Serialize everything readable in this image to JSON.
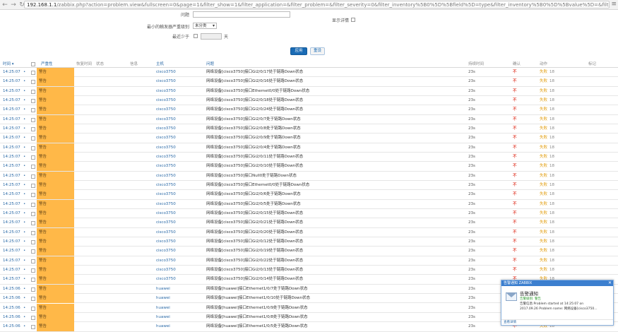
{
  "browser": {
    "back_icon": "back-arrow-icon",
    "forward_icon": "forward-arrow-icon",
    "url_host": "192.168.1.1",
    "url_path": "/zabbix.php?action=problem.view&fullscreen=0&page=1&filter_show=1&filter_application=&filter_problem=&filter_severity=0&filter_inventory%5B0%5D%5Bfield%5D=type&filter_inventory%5B0%5D%5Bvalue%5D=&filter_tags%5B0%5D",
    "menu_icon": "menu-icon"
  },
  "filter": {
    "problem_label": "问题",
    "problem_value": "",
    "min_severity_label": "最小的触发器严重级别",
    "min_severity_value": "未分类",
    "show_details_label": "显示详情",
    "age_label": "最近少于",
    "age_value": "",
    "age_unit": "天",
    "apply_label": "应用",
    "reset_label": "重设"
  },
  "table": {
    "headers": {
      "time": "时间 ▾",
      "severity": "严重性",
      "recovery_time": "恢复时间",
      "status": "状态",
      "info": "信息",
      "host": "主机",
      "problem": "问题",
      "duration": "持续时间",
      "ack": "确认",
      "actions": "动作",
      "tags": "标记"
    },
    "rows": [
      {
        "time": "14:25:07",
        "severity": "警告",
        "host": "cisco3750",
        "problem": "网络设备[cisco3750]接口Gi2/0/17处于链路Down状态",
        "duration": "23s",
        "ack": "不",
        "actions": "失败",
        "actions_count": "18"
      },
      {
        "time": "14:25:07",
        "severity": "警告",
        "host": "cisco3750",
        "problem": "网络设备[cisco3750]接口Gi2/0/16处于链路Down状态",
        "duration": "23s",
        "ack": "不",
        "actions": "失败",
        "actions_count": "18"
      },
      {
        "time": "14:25:07",
        "severity": "警告",
        "host": "cisco3750",
        "problem": "网络设备[cisco3750]接口Ethernet0/0处于链路Down状态",
        "duration": "23s",
        "ack": "不",
        "actions": "失败",
        "actions_count": "18"
      },
      {
        "time": "14:25:07",
        "severity": "警告",
        "host": "cisco3750",
        "problem": "网络设备[cisco3750]接口Gi2/0/18处于链路Down状态",
        "duration": "23s",
        "ack": "不",
        "actions": "失败",
        "actions_count": "18"
      },
      {
        "time": "14:25:07",
        "severity": "警告",
        "host": "cisco3750",
        "problem": "网络设备[cisco3750]接口Gi2/0/24处于链路Down状态",
        "duration": "23s",
        "ack": "不",
        "actions": "失败",
        "actions_count": "18"
      },
      {
        "time": "14:25:07",
        "severity": "警告",
        "host": "cisco3750",
        "problem": "网络设备[cisco3750]接口Gi2/0/7处于链路Down状态",
        "duration": "23s",
        "ack": "不",
        "actions": "失败",
        "actions_count": "18"
      },
      {
        "time": "14:25:07",
        "severity": "警告",
        "host": "cisco3750",
        "problem": "网络设备[cisco3750]接口Gi2/0/8处于链路Down状态",
        "duration": "23s",
        "ack": "不",
        "actions": "失败",
        "actions_count": "18"
      },
      {
        "time": "14:25:07",
        "severity": "警告",
        "host": "cisco3750",
        "problem": "网络设备[cisco3750]接口Gi2/0/9处于链路Down状态",
        "duration": "23s",
        "ack": "不",
        "actions": "失败",
        "actions_count": "18"
      },
      {
        "time": "14:25:07",
        "severity": "警告",
        "host": "cisco3750",
        "problem": "网络设备[cisco3750]接口Gi2/0/4处于链路Down状态",
        "duration": "23s",
        "ack": "不",
        "actions": "失败",
        "actions_count": "18"
      },
      {
        "time": "14:25:07",
        "severity": "警告",
        "host": "cisco3750",
        "problem": "网络设备[cisco3750]接口Gi2/0/11处于链路Down状态",
        "duration": "23s",
        "ack": "不",
        "actions": "失败",
        "actions_count": "18"
      },
      {
        "time": "14:25:07",
        "severity": "警告",
        "host": "cisco3750",
        "problem": "网络设备[cisco3750]接口Gi2/0/10处于链路Down状态",
        "duration": "23s",
        "ack": "不",
        "actions": "失败",
        "actions_count": "18"
      },
      {
        "time": "14:25:07",
        "severity": "警告",
        "host": "cisco3750",
        "problem": "网络设备[cisco3750]接口Null0处于链路Down状态",
        "duration": "23s",
        "ack": "不",
        "actions": "失败",
        "actions_count": "18"
      },
      {
        "time": "14:25:07",
        "severity": "警告",
        "host": "cisco3750",
        "problem": "网络设备[cisco3750]接口Ethernet0/0处于链路Down状态",
        "duration": "23s",
        "ack": "不",
        "actions": "失败",
        "actions_count": "18"
      },
      {
        "time": "14:25:07",
        "severity": "警告",
        "host": "cisco3750",
        "problem": "网络设备[cisco3750]接口Gi2/0/6处于链路Down状态",
        "duration": "23s",
        "ack": "不",
        "actions": "失败",
        "actions_count": "18"
      },
      {
        "time": "14:25:07",
        "severity": "警告",
        "host": "cisco3750",
        "problem": "网络设备[cisco3750]接口Gi2/0/5处于链路Down状态",
        "duration": "23s",
        "ack": "不",
        "actions": "失败",
        "actions_count": "18"
      },
      {
        "time": "14:25:07",
        "severity": "警告",
        "host": "cisco3750",
        "problem": "网络设备[cisco3750]接口Gi2/0/15处于链路Down状态",
        "duration": "23s",
        "ack": "不",
        "actions": "失败",
        "actions_count": "18"
      },
      {
        "time": "14:25:07",
        "severity": "警告",
        "host": "cisco3750",
        "problem": "网络设备[cisco3750]接口Gi2/0/21处于链路Down状态",
        "duration": "23s",
        "ack": "不",
        "actions": "失败",
        "actions_count": "18"
      },
      {
        "time": "14:25:07",
        "severity": "警告",
        "host": "cisco3750",
        "problem": "网络设备[cisco3750]接口Gi2/0/20处于链路Down状态",
        "duration": "23s",
        "ack": "不",
        "actions": "失败",
        "actions_count": "18"
      },
      {
        "time": "14:25:07",
        "severity": "警告",
        "host": "cisco3750",
        "problem": "网络设备[cisco3750]接口Gi2/0/12处于链路Down状态",
        "duration": "23s",
        "ack": "不",
        "actions": "失败",
        "actions_count": "18"
      },
      {
        "time": "14:25:07",
        "severity": "警告",
        "host": "cisco3750",
        "problem": "网络设备[cisco3750]接口Gi2/0/19处于链路Down状态",
        "duration": "23s",
        "ack": "不",
        "actions": "失败",
        "actions_count": "18"
      },
      {
        "time": "14:25:07",
        "severity": "警告",
        "host": "cisco3750",
        "problem": "网络设备[cisco3750]接口Gi2/0/22处于链路Down状态",
        "duration": "23s",
        "ack": "不",
        "actions": "失败",
        "actions_count": "18"
      },
      {
        "time": "14:25:07",
        "severity": "警告",
        "host": "cisco3750",
        "problem": "网络设备[cisco3750]接口Gi2/0/13处于链路Down状态",
        "duration": "23s",
        "ack": "不",
        "actions": "失败",
        "actions_count": "18"
      },
      {
        "time": "14:25:07",
        "severity": "警告",
        "host": "cisco3750",
        "problem": "网络设备[cisco3750]接口Gi2/0/14处于链路Down状态",
        "duration": "23s",
        "ack": "不",
        "actions": "失败",
        "actions_count": "18"
      },
      {
        "time": "14:25:06",
        "severity": "警告",
        "host": "huawei",
        "problem": "网络设备[huawei]接口Ethernet1/0/7处于链路Down状态",
        "duration": "23s",
        "ack": "不",
        "actions": "失败",
        "actions_count": "18"
      },
      {
        "time": "14:25:06",
        "severity": "警告",
        "host": "huawei",
        "problem": "网络设备[huawei]接口Ethernet1/0/10处于链路Down状态",
        "duration": "23s",
        "ack": "不",
        "actions": "失败",
        "actions_count": "18"
      },
      {
        "time": "14:25:06",
        "severity": "警告",
        "host": "huawei",
        "problem": "网络设备[huawei]接口Ethernet1/0/9处于链路Down状态",
        "duration": "23s",
        "ack": "不",
        "actions": "失败",
        "actions_count": "18"
      },
      {
        "time": "14:25:06",
        "severity": "警告",
        "host": "huawei",
        "problem": "网络设备[huawei]接口Ethernet1/0/8处于链路Down状态",
        "duration": "23s",
        "ack": "不",
        "actions": "失败",
        "actions_count": "18"
      },
      {
        "time": "14:25:06",
        "severity": "警告",
        "host": "huawei",
        "problem": "网络设备[huawei]接口Ethernet1/0/5处于链路Down状态",
        "duration": "23s",
        "ack": "不",
        "actions": "失败",
        "actions_count": "18"
      }
    ]
  },
  "popup": {
    "bar_title": "告警通知 ZABBIX",
    "title": "告警通知",
    "line1": "告警级别: 警告",
    "line2": "告警信息:Problem started at 14:25:07 on",
    "line3": "2017.09.26 Problem name: 网络设备[cisco3750...",
    "footer": "查看详情",
    "close_icon": "close-icon",
    "mail_icon": "mail-icon"
  },
  "colors": {
    "severity_warning": "#ffb848",
    "link": "#2b6aa7",
    "apply_button": "#1a6bb5",
    "ack_no": "#e34b3c",
    "action_failed": "#e3a015"
  }
}
